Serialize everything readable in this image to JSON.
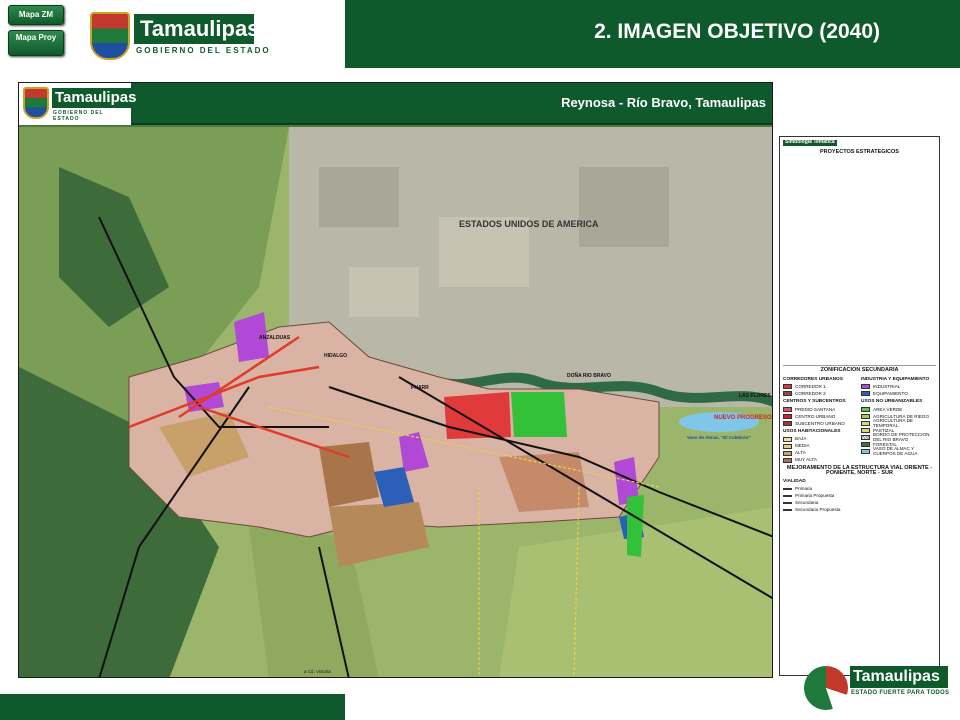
{
  "header": {
    "nav_buttons": [
      {
        "label": "Mapa ZM"
      },
      {
        "label": "Mapa Proy"
      }
    ],
    "brand": "Tamaulipas",
    "brand_sub": "GOBIERNO DEL ESTADO",
    "page_title": "2. IMAGEN OBJETIVO (2040)"
  },
  "map": {
    "brand": "Tamaulipas",
    "brand_sub": "GOBIERNO DEL ESTADO",
    "location": "Reynosa - Río Bravo, Tamaulipas",
    "country_label": "ESTADOS UNIDOS DE AMERICA",
    "places": [
      "ANZALDUAS",
      "HIDALGO",
      "PHARR",
      "DOÑA RIO BRAVO",
      "LAS FLORES",
      "NUEVO PROGRESO",
      "Vaso de Almac. \"El Culebrón\""
    ],
    "road_label": "a Cd. Victoria"
  },
  "legend": {
    "title": "Simbología Temática",
    "projects_heading": "PROYECTOS ESTRATEGICOS",
    "zoning_heading": "ZONIFICACION SECUNDARIA",
    "corredores": {
      "heading": "CORREDORES URBANOS",
      "items": [
        {
          "label": "CORREDOR 1",
          "color": "#d63a3a"
        },
        {
          "label": "CORREDOR 2",
          "color": "#8a4a4a"
        }
      ]
    },
    "centros": {
      "heading": "CENTROS Y SUBCENTROS",
      "items": [
        {
          "label": "PREDIO SANTANA",
          "color": "#e8505b"
        },
        {
          "label": "CENTRO URBANO",
          "color": "#d61f26"
        },
        {
          "label": "SUBCENTRO URBANO",
          "color": "#9e3a3a"
        }
      ]
    },
    "habitacionales": {
      "heading": "USOS HABITACIONALES",
      "items": [
        {
          "label": "BAJA",
          "color": "#f3e09a"
        },
        {
          "label": "MEDIA",
          "color": "#e7c98c"
        },
        {
          "label": "ALTA",
          "color": "#c9a06a"
        },
        {
          "label": "MUY ALTA",
          "color": "#a8754a"
        }
      ]
    },
    "industria": {
      "heading": "INDUSTRIA Y EQUIPAMIENTO",
      "items": [
        {
          "label": "INDUSTRIAL",
          "color": "#b04ad6"
        },
        {
          "label": "EQUIPAMIENTO",
          "color": "#2c5fb8"
        }
      ]
    },
    "no_urbanizables": {
      "heading": "USOS NO URBANIZABLES",
      "items": [
        {
          "label": "AREA VERDE",
          "color": "#5ac83c"
        },
        {
          "label": "AGRICULTURA DE RIEGO",
          "color": "#a8c460"
        },
        {
          "label": "AGRICULTURA DE TEMPORAL",
          "color": "#cfd98a"
        },
        {
          "label": "PASTIZAL",
          "color": "#d8d36a"
        },
        {
          "label": "BORDO DE PROTECCION DEL RIO BRAVO",
          "color": "#888888"
        },
        {
          "label": "FORESTAL",
          "color": "#2f7a3a"
        },
        {
          "label": "VASO DE ALMAC Y CUERPOS DE AGUA",
          "color": "#7fc6e8"
        }
      ]
    },
    "vial_heading": "MEJORAMIENTO DE LA ESTRUCTURA VIAL ORIENTE - PONIENTE, NORTE - SUR",
    "vialidad_heading": "VIALIDAD",
    "vialidad": [
      {
        "label": "Primaria",
        "color": "#111111"
      },
      {
        "label": "Primaria Propuesta",
        "color": "#555555"
      },
      {
        "label": "Secundaria",
        "color": "#e03a2a"
      },
      {
        "label": "Secundaria Propuesta",
        "color": "#e88a7a"
      }
    ]
  },
  "footer": {
    "brand": "Tamaulipas",
    "slogan": "ESTADO FUERTE PARA TODOS"
  }
}
